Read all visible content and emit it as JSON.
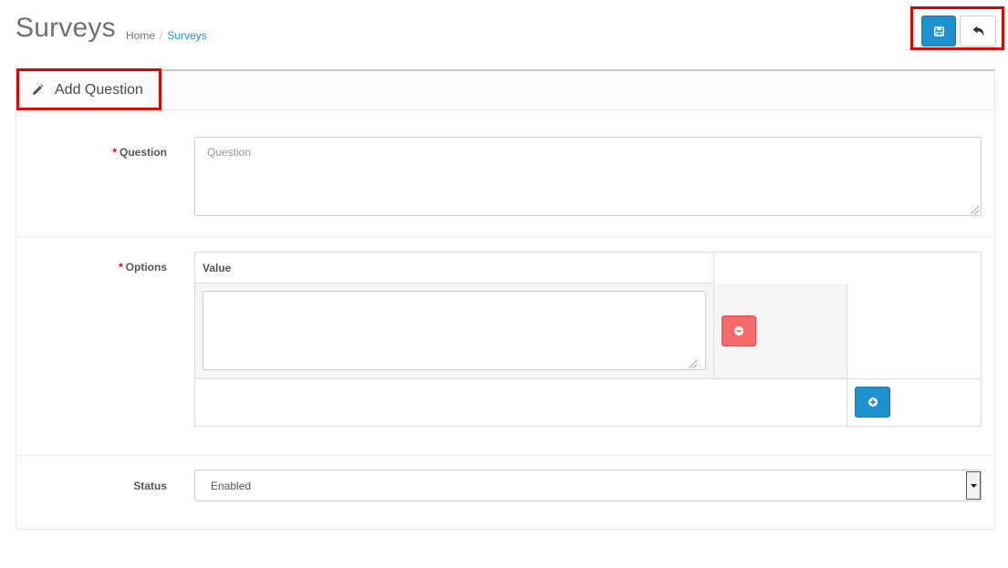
{
  "header": {
    "title": "Surveys",
    "breadcrumb": [
      "Home",
      "Surveys"
    ],
    "separator": "/"
  },
  "actions": {
    "save_icon": "floppy-disk-icon",
    "back_icon": "reply-arrow-icon"
  },
  "panel": {
    "title": "Add Question",
    "title_icon": "pencil-icon"
  },
  "form": {
    "required_marker": "*",
    "question": {
      "label": "Question",
      "placeholder": "Question",
      "value": ""
    },
    "options": {
      "label": "Options",
      "column_header": "Value",
      "rows": [
        {
          "value": ""
        }
      ],
      "remove_icon": "minus-circle-icon",
      "add_icon": "plus-circle-icon"
    },
    "status": {
      "label": "Status",
      "selected": "Enabled"
    }
  },
  "colors": {
    "primary": "#1e91cf",
    "danger": "#f56b6b",
    "highlight": "#e20000",
    "required": "#f00000"
  }
}
